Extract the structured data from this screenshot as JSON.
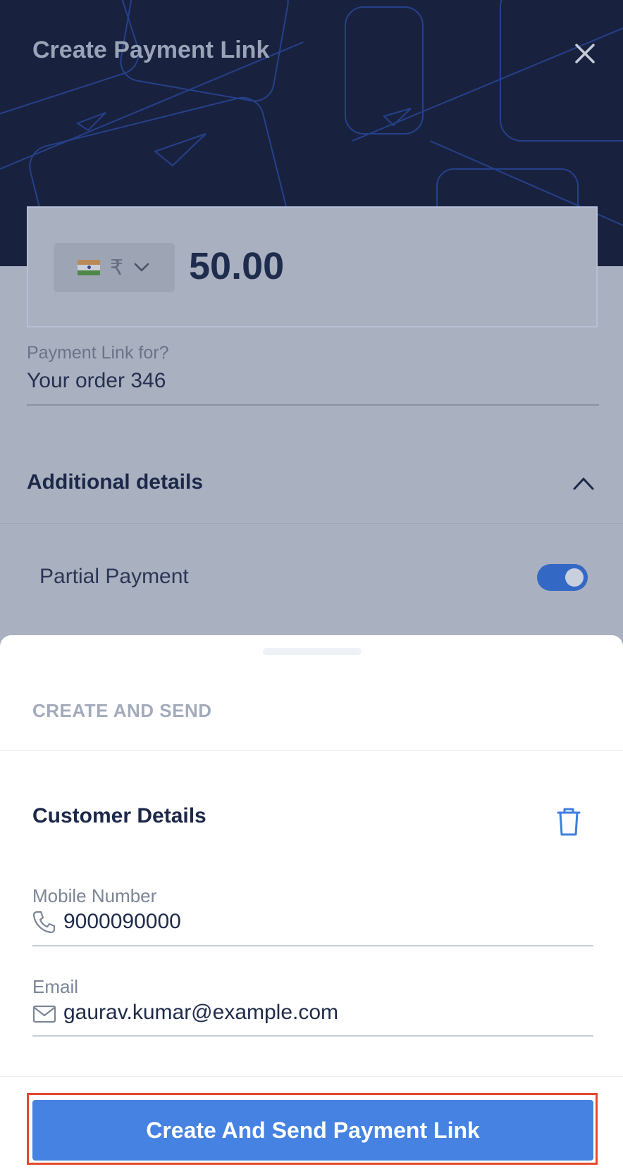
{
  "header": {
    "title": "Create Payment Link",
    "close_icon": "close-icon"
  },
  "amount": {
    "flag_icon": "india-flag-icon",
    "currency_symbol": "₹",
    "dropdown_icon": "chevron-down-icon",
    "value": "50.00"
  },
  "description_field": {
    "label": "Payment Link for?",
    "value": "Your order 346"
  },
  "additional_details": {
    "title": "Additional details",
    "collapse_icon": "chevron-up-icon",
    "partial_payment_label": "Partial Payment",
    "partial_payment_enabled": true
  },
  "sheet": {
    "heading": "CREATE AND SEND",
    "customer_title": "Customer Details",
    "delete_icon": "trash-icon",
    "mobile": {
      "label": "Mobile Number",
      "value": "9000090000",
      "icon": "phone-icon"
    },
    "email": {
      "label": "Email",
      "value": "gaurav.kumar@example.com",
      "icon": "mail-icon"
    },
    "submit_label": "Create And Send Payment Link"
  },
  "colors": {
    "header_bg": "#18223f",
    "overlay_bg": "#a9b0bf",
    "accent": "#4582e2",
    "toggle_on": "#3468c5",
    "highlight_border": "#e24a2f"
  }
}
